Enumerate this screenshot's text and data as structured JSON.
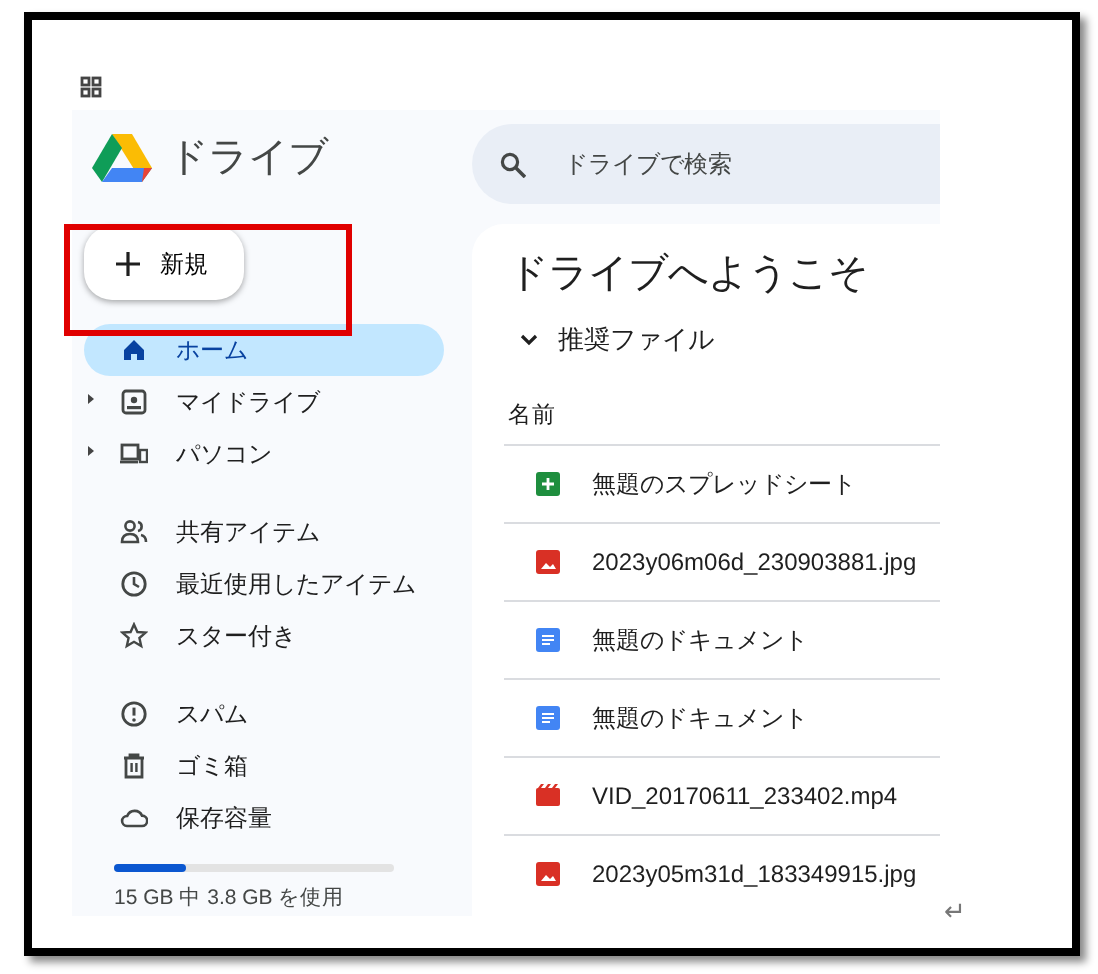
{
  "drive": {
    "logo_text": "ドライブ",
    "search": {
      "placeholder": "ドライブで検索"
    },
    "new_button": {
      "label": "新規",
      "highlighted": true
    },
    "nav_groups": [
      {
        "items": [
          {
            "label": "ホーム",
            "selected": true,
            "expandable": false
          },
          {
            "label": "マイドライブ",
            "selected": false,
            "expandable": true
          },
          {
            "label": "パソコン",
            "selected": false,
            "expandable": true
          }
        ]
      },
      {
        "items": [
          {
            "label": "共有アイテム",
            "selected": false,
            "expandable": false
          },
          {
            "label": "最近使用したアイテム",
            "selected": false,
            "expandable": false
          },
          {
            "label": "スター付き",
            "selected": false,
            "expandable": false
          }
        ]
      },
      {
        "items": [
          {
            "label": "スパム",
            "selected": false,
            "expandable": false
          },
          {
            "label": "ゴミ箱",
            "selected": false,
            "expandable": false
          },
          {
            "label": "保存容量",
            "selected": false,
            "expandable": false
          }
        ]
      }
    ],
    "storage": {
      "level": 0.26,
      "text": "15 GB 中 3.8 GB を使用"
    },
    "main": {
      "title": "ドライブへようこそ",
      "section": {
        "label": "推奨ファイル",
        "expanded": true
      },
      "column": "名前",
      "files": [
        {
          "kind": "sheet",
          "name": "無題のスプレッドシート"
        },
        {
          "kind": "image",
          "name": "2023y06m06d_230903881.jpg"
        },
        {
          "kind": "doc",
          "name": "無題のドキュメント"
        },
        {
          "kind": "doc",
          "name": "無題のドキュメント"
        },
        {
          "kind": "video",
          "name": "VID_20170611_233402.mp4"
        },
        {
          "kind": "image",
          "name": "2023y05m31d_183349915.jpg"
        }
      ]
    }
  },
  "return_mark": "↵"
}
